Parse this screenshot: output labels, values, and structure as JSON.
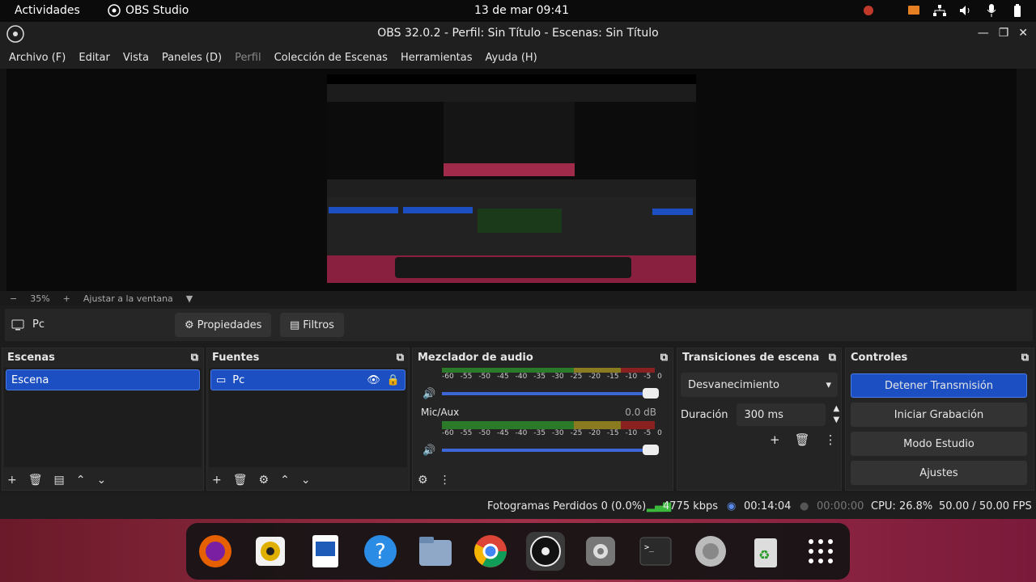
{
  "topbar": {
    "activities": "Actividades",
    "app_name": "OBS Studio",
    "clock": "13 de mar  09:41"
  },
  "window": {
    "title": "OBS 32.0.2 - Perfil: Sin Título - Escenas: Sin Título"
  },
  "menu": {
    "items": [
      "Archivo (F)",
      "Editar",
      "Vista",
      "Paneles (D)",
      "Perfil",
      "Colección de Escenas",
      "Herramientas",
      "Ayuda (H)"
    ]
  },
  "zoom": {
    "level": "35%",
    "fit_label": "Ajustar a la ventana"
  },
  "source_toolbar": {
    "source_name": "Pc",
    "properties_label": "Propiedades",
    "filters_label": "Filtros"
  },
  "scenes": {
    "title": "Escenas",
    "items": [
      "Escena"
    ]
  },
  "sources": {
    "title": "Fuentes",
    "items": [
      "Pc"
    ]
  },
  "mixer": {
    "title": "Mezclador de audio",
    "ticks": [
      "-60",
      "-55",
      "-50",
      "-45",
      "-40",
      "-35",
      "-30",
      "-25",
      "-20",
      "-15",
      "-10",
      "-5",
      "0"
    ],
    "channel_name": "Mic/Aux",
    "channel_db": "0.0 dB"
  },
  "transitions": {
    "title": "Transiciones de escena",
    "selected": "Desvanecimiento",
    "duration_label": "Duración",
    "duration_value": "300 ms"
  },
  "controls": {
    "title": "Controles",
    "stop_stream": "Detener Transmisión",
    "start_record": "Iniciar Grabación",
    "studio_mode": "Modo Estudio",
    "settings": "Ajustes"
  },
  "status": {
    "dropped": "Fotogramas Perdidos 0 (0.0%)",
    "bitrate": "4775 kbps",
    "stream_time": "00:14:04",
    "record_time": "00:00:00",
    "cpu": "CPU: 26.8%",
    "fps": "50.00 / 50.00 FPS"
  },
  "colors": {
    "accent": "#1c4fc2",
    "panel": "#242424"
  }
}
